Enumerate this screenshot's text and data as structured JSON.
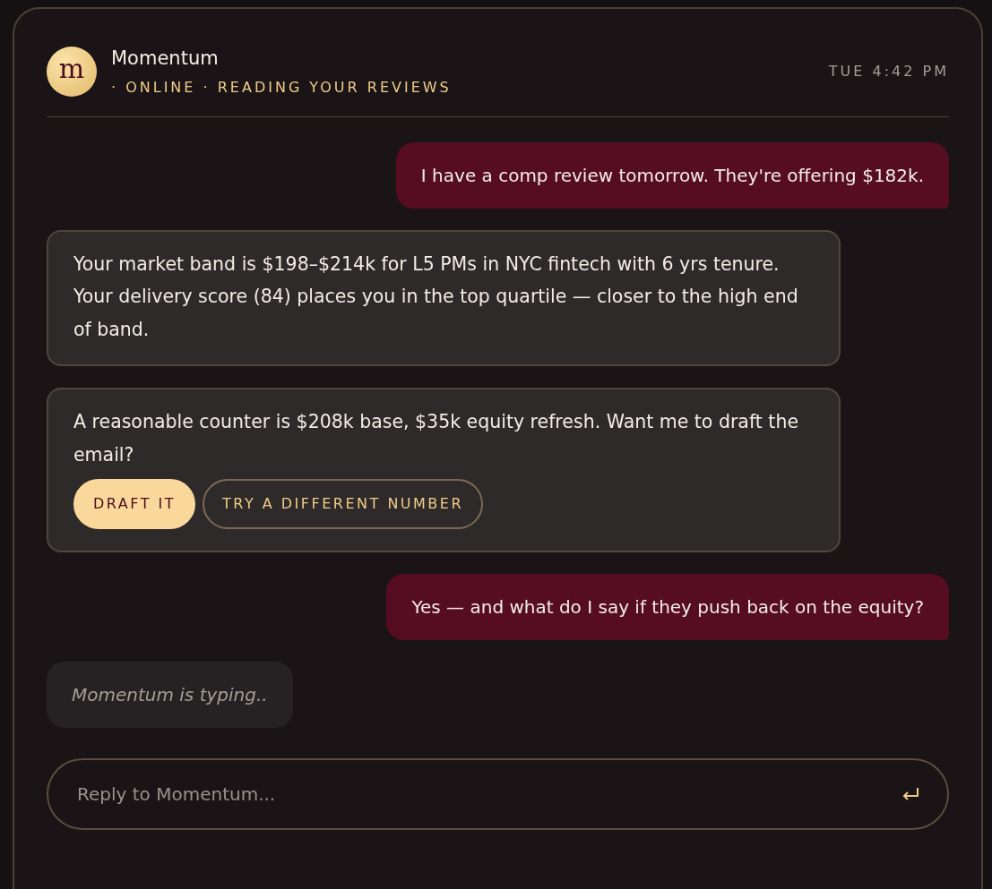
{
  "header": {
    "avatar_letter": "m",
    "name": "Momentum",
    "status": "· ONLINE · READING YOUR REVIEWS",
    "time": "TUE 4:42 PM"
  },
  "messages": [
    {
      "kind": "user",
      "text": "I have a comp review tomorrow. They're offering $182k."
    },
    {
      "kind": "bot",
      "text": "Your market band is $198–$214k for L5 PMs in NYC fintech with 6 yrs tenure. Your delivery score (84) places you in the top quartile — closer to the high end of band."
    },
    {
      "kind": "bot",
      "text": "A reasonable counter is $208k base, $35k equity refresh. Want me to draft the email?",
      "actions": [
        {
          "label": "DRAFT IT",
          "primary": true
        },
        {
          "label": "TRY A DIFFERENT NUMBER",
          "primary": false
        }
      ]
    },
    {
      "kind": "user",
      "text": "Yes — and what do I say if they push back on the equity?"
    },
    {
      "kind": "typing",
      "text": "Momentum is typing.."
    }
  ],
  "composer": {
    "placeholder": "Reply to Momentum..."
  }
}
